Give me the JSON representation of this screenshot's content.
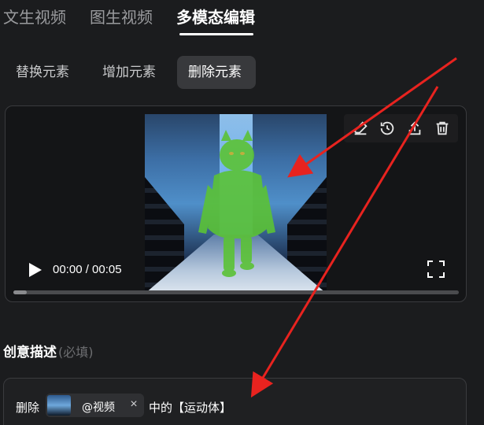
{
  "top_tabs": [
    {
      "label": "文生视频"
    },
    {
      "label": "图生视频"
    },
    {
      "label": "多模态编辑"
    }
  ],
  "sub_tabs": [
    {
      "label": "替换元素"
    },
    {
      "label": "增加元素"
    },
    {
      "label": "删除元素"
    }
  ],
  "player": {
    "time": "00:00 / 00:05",
    "progress": 0.03,
    "toolbar_icons": [
      "eraser-icon",
      "history-icon",
      "upload-icon",
      "trash-icon"
    ]
  },
  "section": {
    "title": "创意描述",
    "hint": "(必填)"
  },
  "prompt": {
    "prefix": "删除",
    "chip_label": "@视频",
    "chip_close": "×",
    "suffix": "中的【运动体】"
  },
  "colors": {
    "background": "#1b1c1e",
    "active_tab": "#ffffff",
    "selected_subtab_bg": "#38393c",
    "highlight_green": "#5bc236",
    "arrow_red": "#e8231f"
  }
}
